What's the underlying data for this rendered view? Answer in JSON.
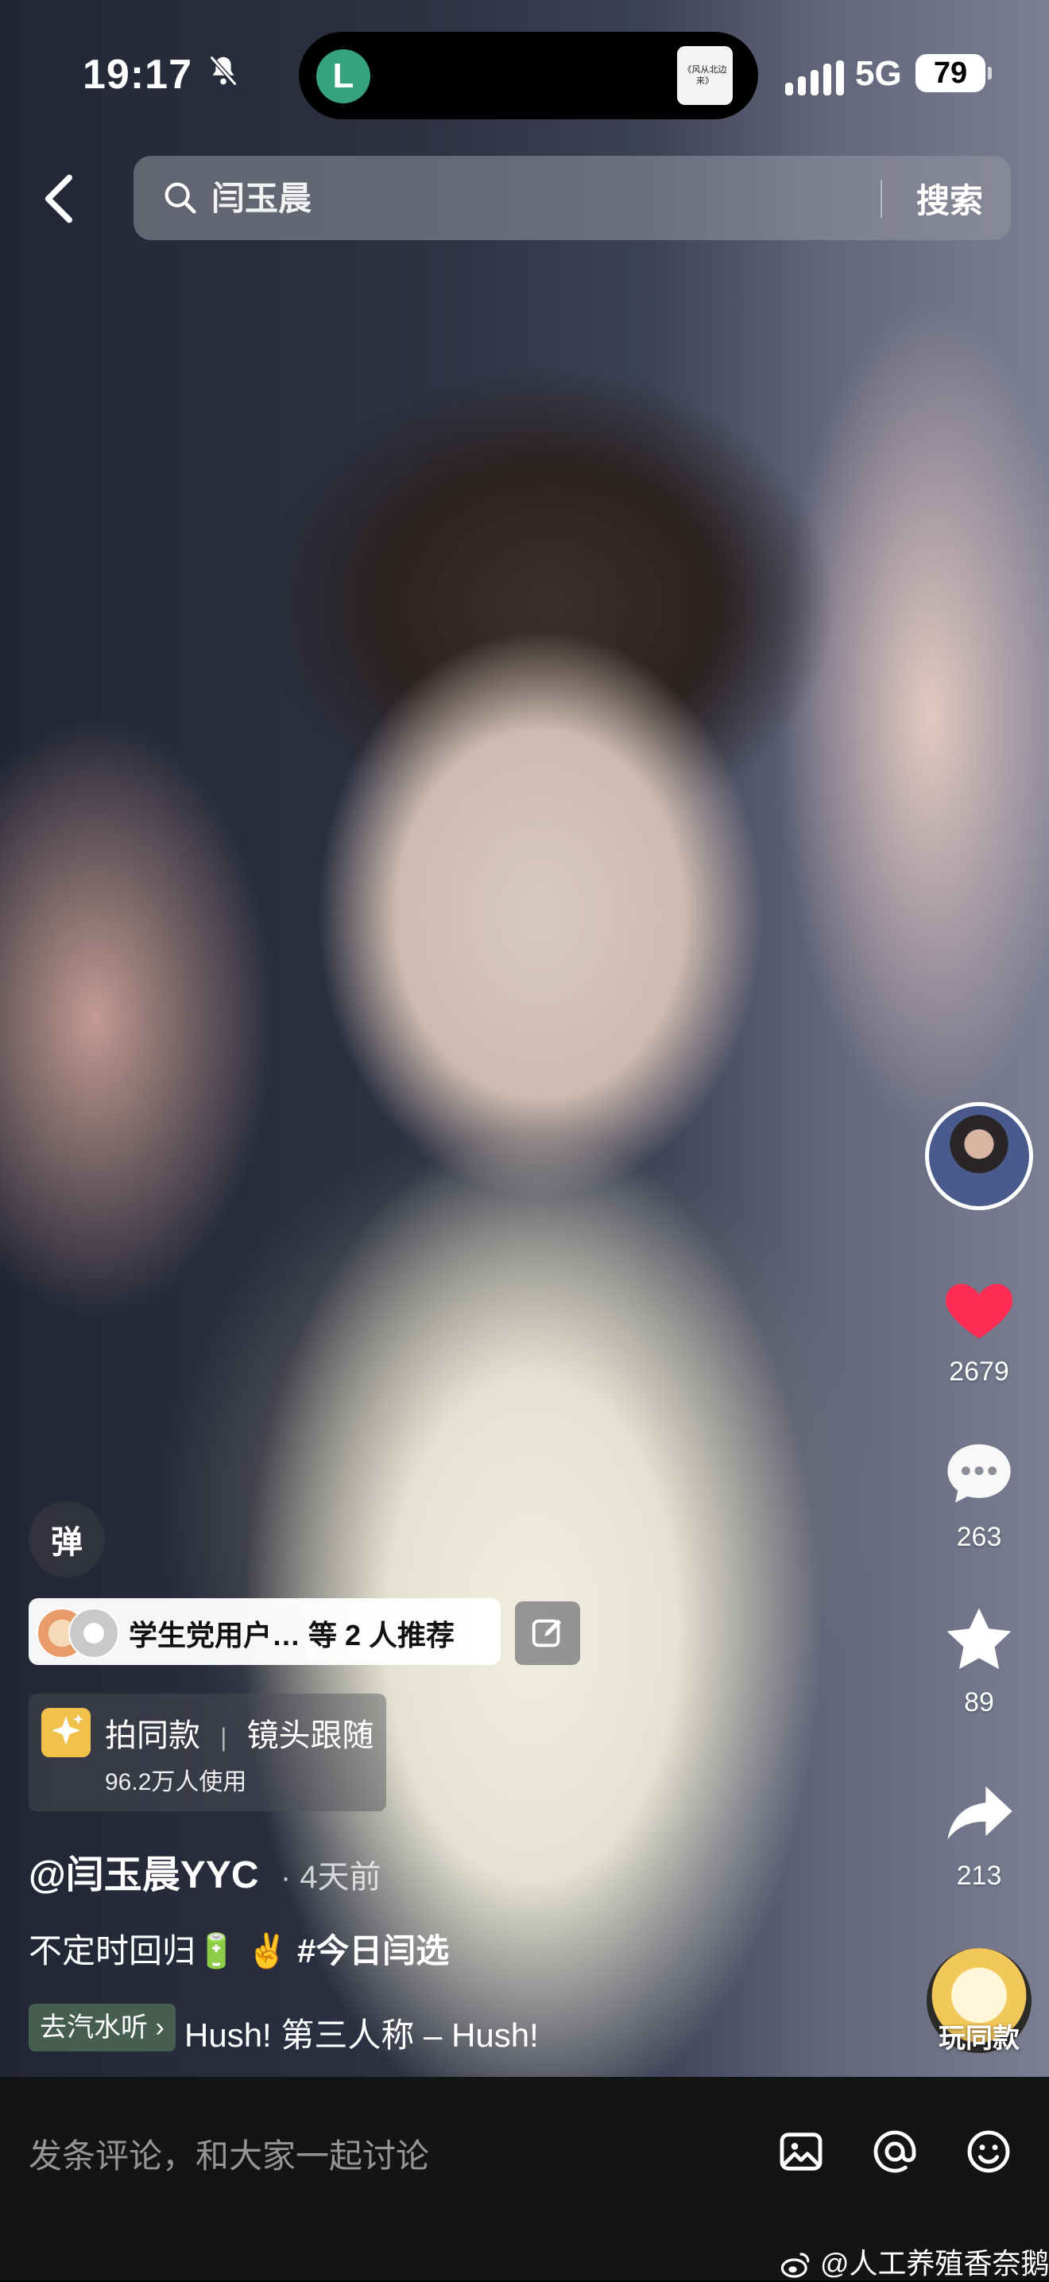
{
  "status_bar": {
    "time": "19:17",
    "network": "5G",
    "battery": "79",
    "island_app_letter": "L",
    "island_thumb_text": "《风从北边来》"
  },
  "search": {
    "query": "闫玉晨",
    "button_label": "搜索"
  },
  "actions": {
    "likes": "2679",
    "comments": "263",
    "favorites": "89",
    "shares": "213",
    "play_same_label": "玩同款"
  },
  "overlay": {
    "danmaku_label": "弹",
    "recommend_text": "学生党用户… 等 2 人推荐",
    "filter_title": "拍同款",
    "filter_effect": "镜头跟随",
    "filter_users": "96.2万人使用",
    "author": "@闫玉晨YYC",
    "time_ago": "· 4天前",
    "caption_text": "不定时回归🔋 ✌️",
    "caption_hashtag": "#今日闫选",
    "music_tag": "去汽水听 ›",
    "music_text": "Hush!    第三人称 – Hush!"
  },
  "bottom_bar": {
    "comment_placeholder": "发条评论，和大家一起讨论"
  },
  "watermark": "@人工养殖香奈鹅",
  "colors": {
    "like": "#ff2d55",
    "accent_filter": "#f1c24b"
  },
  "icons": [
    "bell-slash-icon",
    "signal-icon",
    "back-chevron-icon",
    "search-icon",
    "heart-icon",
    "comment-bubble-icon",
    "star-icon",
    "share-arrow-icon",
    "edit-icon",
    "sparkle-icon",
    "image-icon",
    "at-icon",
    "emoji-icon",
    "weibo-icon"
  ]
}
